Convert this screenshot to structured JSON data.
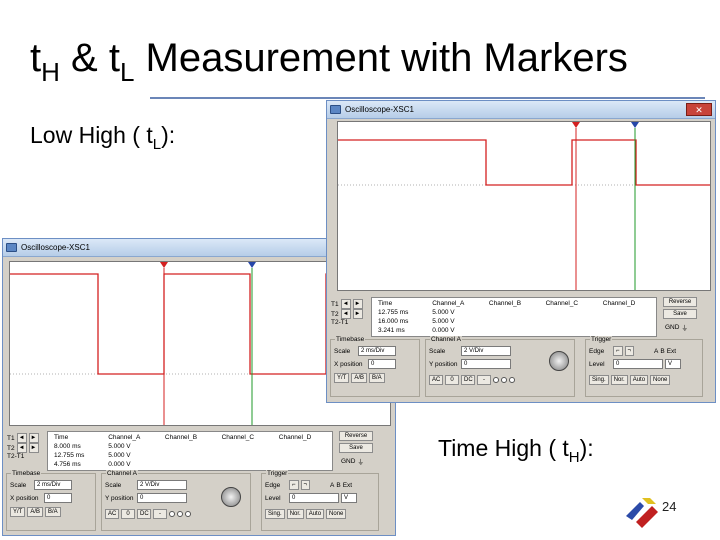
{
  "slide": {
    "title_a": "t",
    "title_a_sub": "H",
    "title_b": " & t",
    "title_b_sub": "L",
    "title_c": " Measurement with Markers",
    "caption_low": "Low High ( t",
    "caption_low_sub": "L",
    "caption_low_end": "):",
    "caption_high": "Time High ( t",
    "caption_high_sub": "H",
    "caption_high_end": "):",
    "page_number": "24",
    "rule_color": "#6b86b8"
  },
  "windows": [
    {
      "title": "Oscilloscope-XSC1",
      "close_label": "✕",
      "measurements": {
        "headers": [
          "Time",
          "Channel_A",
          "Channel_B",
          "Channel_C",
          "Channel_D"
        ],
        "rows": [
          {
            "label": "T1",
            "time": "8.000 ms",
            "a": "5.000 V"
          },
          {
            "label": "T2",
            "time": "12.755 ms",
            "a": "5.000 V"
          },
          {
            "label": "T2-T1",
            "time": "4.756 ms",
            "a": "0.000 V"
          }
        ]
      },
      "reverse_label": "Reverse",
      "save_label": "Save",
      "gnd_label": "GND",
      "timebase": {
        "label": "Timebase",
        "scale_label": "Scale",
        "scale": "2 ms/Div",
        "xpos_label": "X position",
        "xpos": "0",
        "modes": [
          "Y/T",
          "A/B",
          "B/A"
        ]
      },
      "channel": {
        "label": "Channel A",
        "scale_label": "Scale",
        "scale": "2 V/Div",
        "ypos_label": "Y position",
        "ypos": "0",
        "coupling": [
          "AC",
          "0",
          "DC",
          "-"
        ]
      },
      "trigger": {
        "label": "Trigger",
        "edge_label": "Edge",
        "level_label": "Level",
        "level": "0",
        "level_unit": "V",
        "source_a": "A",
        "source_b": "B",
        "ext": "Ext",
        "modes": [
          "Sing.",
          "Nor.",
          "Auto",
          "None"
        ]
      }
    },
    {
      "title": "Oscilloscope-XSC1",
      "close_label": "✕",
      "measurements": {
        "headers": [
          "Time",
          "Channel_A",
          "Channel_B",
          "Channel_C",
          "Channel_D"
        ],
        "rows": [
          {
            "label": "T1",
            "time": "12.755 ms",
            "a": "5.000 V"
          },
          {
            "label": "T2",
            "time": "16.000 ms",
            "a": "5.000 V"
          },
          {
            "label": "T2-T1",
            "time": "3.241 ms",
            "a": "0.000 V"
          }
        ]
      },
      "reverse_label": "Reverse",
      "save_label": "Save",
      "gnd_label": "GND",
      "timebase": {
        "label": "Timebase",
        "scale_label": "Scale",
        "scale": "2 ms/Div",
        "xpos_label": "X position",
        "xpos": "0",
        "modes": [
          "Y/T",
          "A/B",
          "B/A"
        ]
      },
      "channel": {
        "label": "Channel A",
        "scale_label": "Scale",
        "scale": "2 V/Div",
        "ypos_label": "Y position",
        "ypos": "0",
        "coupling": [
          "AC",
          "0",
          "DC",
          "-"
        ]
      },
      "trigger": {
        "label": "Trigger",
        "edge_label": "Edge",
        "level_label": "Level",
        "level": "0",
        "level_unit": "V",
        "source_a": "A",
        "source_b": "B",
        "ext": "Ext",
        "modes": [
          "Sing.",
          "Nor.",
          "Auto",
          "None"
        ]
      }
    }
  ],
  "colors": {
    "trace": "#d42020",
    "cursor1": "#d42020",
    "cursor2": "#1f9a2a",
    "grid": "#b0b0b0"
  }
}
